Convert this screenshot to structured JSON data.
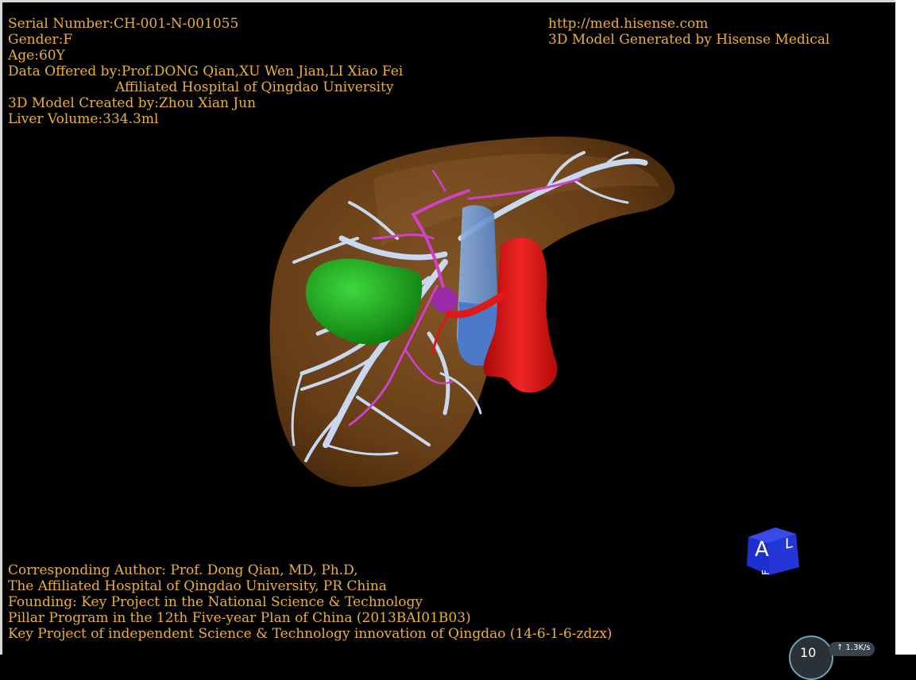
{
  "patient": {
    "serial": "Serial Number:CH-001-N-001055",
    "gender": "Gender:F",
    "age": "Age:60Y",
    "data_offered_1": "Data Offered by:Prof.DONG Qian,XU Wen Jian,LI Xiao Fei",
    "data_offered_2": "Affiliated Hospital of Qingdao University",
    "model_created": "3D Model Created by:Zhou Xian Jun",
    "liver_volume": "Liver Volume:334.3ml"
  },
  "brand": {
    "url": "http://med.hisense.com",
    "generated": "3D Model Generated by Hisense Medical"
  },
  "credits": {
    "author": "Corresponding Author: Prof. Dong Qian, MD, Ph.D,",
    "hospital": "The Affiliated Hospital of Qingdao University, PR China",
    "founding": "Founding: Key Project in the National Science & Technology",
    "pillar": "Pillar Program in the 12th Five-year Plan of China (2013BAI01B03)",
    "key_project": "Key Project of independent Science & Technology innovation of Qingdao (14-6-1-6-zdzx)"
  },
  "orientation_cube": {
    "front": "A",
    "side": "L",
    "top": "F"
  },
  "net_monitor": {
    "value": "10",
    "speed": "↑ 1.3K/s"
  },
  "colors": {
    "text": "#e9b13a",
    "liver": "#7a4a1c",
    "gallbladder": "#1fa81f",
    "portal_vein": "#c8d8f0",
    "hepatic_artery": "#d040c8",
    "ivc": "#6a9ad8",
    "aorta": "#e01818",
    "cube": "#1c2fd0"
  }
}
